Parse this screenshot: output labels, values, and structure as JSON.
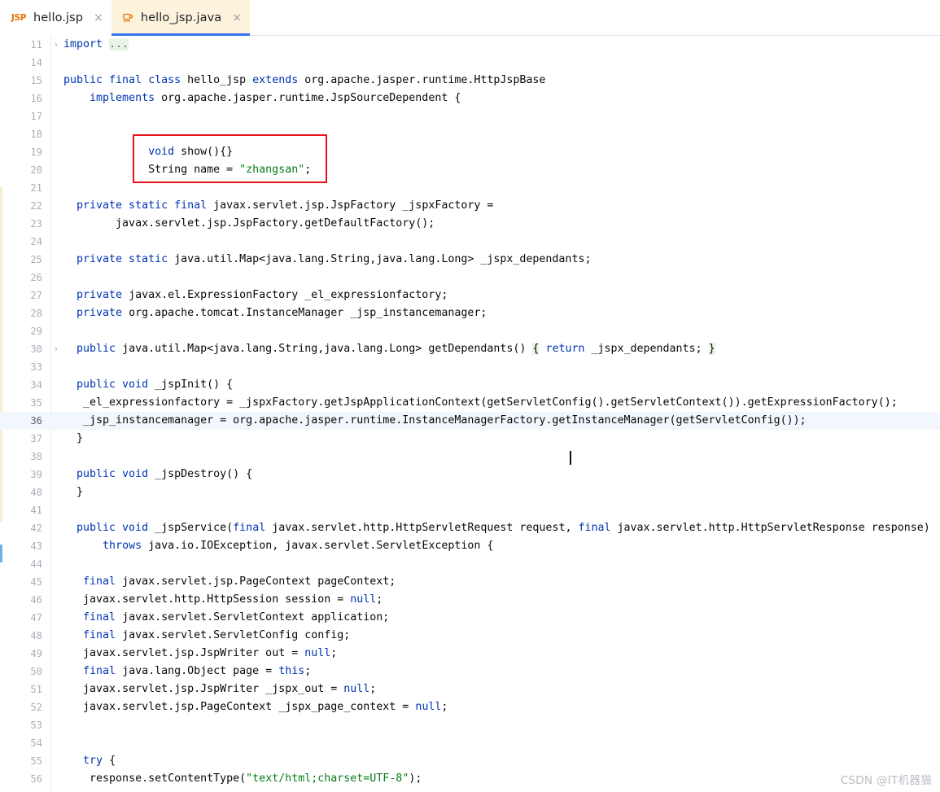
{
  "tabs": [
    {
      "label": "hello.jsp",
      "icon": "jsp-file-icon",
      "icon_text": "JSP",
      "close": "×",
      "active": false
    },
    {
      "label": "hello_jsp.java",
      "icon": "java-file-icon",
      "close": "×",
      "active": true
    }
  ],
  "colors": {
    "active_tab_bg": "#fdf3dc",
    "active_tab_underline": "#3574f0",
    "keyword": "#0033b3",
    "string": "#067d17",
    "annotation_box": "#e8131a",
    "current_line_bg": "#f2f6fd",
    "fold_highlight": "#e9f5e4",
    "line_number": "#aaaeb8"
  },
  "editor": {
    "current_line": 36,
    "lines": [
      {
        "n": "11",
        "fold": "›",
        "indent": 0,
        "tokens": [
          {
            "t": "import ",
            "c": "kw"
          },
          {
            "t": "...",
            "c": "ell"
          }
        ]
      },
      {
        "n": "14",
        "fold": "",
        "indent": 0,
        "tokens": []
      },
      {
        "n": "15",
        "fold": "",
        "indent": 0,
        "tokens": [
          {
            "t": "public final class ",
            "c": "kw"
          },
          {
            "t": "hello_jsp ",
            "c": "plain"
          },
          {
            "t": "extends ",
            "c": "kw"
          },
          {
            "t": "org.apache.jasper.runtime.HttpJspBase",
            "c": "plain"
          }
        ]
      },
      {
        "n": "16",
        "fold": "",
        "indent": 4,
        "tokens": [
          {
            "t": "implements ",
            "c": "kw"
          },
          {
            "t": "org.apache.jasper.runtime.JspSourceDependent {",
            "c": "plain"
          }
        ]
      },
      {
        "n": "17",
        "fold": "",
        "indent": 0,
        "tokens": []
      },
      {
        "n": "18",
        "fold": "",
        "indent": 0,
        "tokens": []
      },
      {
        "n": "19",
        "fold": "",
        "indent": 13,
        "tokens": [
          {
            "t": "void ",
            "c": "kw"
          },
          {
            "t": "show(){}",
            "c": "plain"
          }
        ]
      },
      {
        "n": "20",
        "fold": "",
        "indent": 13,
        "tokens": [
          {
            "t": "String name = ",
            "c": "plain"
          },
          {
            "t": "\"zhangsan\"",
            "c": "str"
          },
          {
            "t": ";",
            "c": "plain"
          }
        ]
      },
      {
        "n": "21",
        "fold": "",
        "indent": 0,
        "tokens": []
      },
      {
        "n": "22",
        "fold": "",
        "indent": 2,
        "tokens": [
          {
            "t": "private static final ",
            "c": "kw"
          },
          {
            "t": "javax.servlet.jsp.JspFactory _jspxFactory =",
            "c": "plain"
          }
        ]
      },
      {
        "n": "23",
        "fold": "",
        "indent": 8,
        "tokens": [
          {
            "t": "javax.servlet.jsp.JspFactory.getDefaultFactory();",
            "c": "plain"
          }
        ]
      },
      {
        "n": "24",
        "fold": "",
        "indent": 0,
        "tokens": []
      },
      {
        "n": "25",
        "fold": "",
        "indent": 2,
        "tokens": [
          {
            "t": "private static ",
            "c": "kw"
          },
          {
            "t": "java.util.Map<java.lang.String,java.lang.Long> _jspx_dependants;",
            "c": "plain"
          }
        ]
      },
      {
        "n": "26",
        "fold": "",
        "indent": 0,
        "tokens": []
      },
      {
        "n": "27",
        "fold": "",
        "indent": 2,
        "tokens": [
          {
            "t": "private ",
            "c": "kw"
          },
          {
            "t": "javax.el.ExpressionFactory _el_expressionfactory;",
            "c": "plain"
          }
        ]
      },
      {
        "n": "28",
        "fold": "",
        "indent": 2,
        "tokens": [
          {
            "t": "private ",
            "c": "kw"
          },
          {
            "t": "org.apache.tomcat.InstanceManager _jsp_instancemanager;",
            "c": "plain"
          }
        ]
      },
      {
        "n": "29",
        "fold": "",
        "indent": 0,
        "tokens": []
      },
      {
        "n": "30",
        "fold": "›",
        "indent": 2,
        "tokens": [
          {
            "t": "public ",
            "c": "kw"
          },
          {
            "t": "java.util.Map<java.lang.String,java.lang.Long> getDependants() ",
            "c": "plain"
          },
          {
            "t": "{",
            "c": "foldmark"
          },
          {
            "t": " ",
            "c": "plain"
          },
          {
            "t": "return",
            "c": "kw"
          },
          {
            "t": " _jspx_dependants; ",
            "c": "plain"
          },
          {
            "t": "}",
            "c": "foldmark"
          }
        ]
      },
      {
        "n": "33",
        "fold": "",
        "indent": 0,
        "tokens": []
      },
      {
        "n": "34",
        "fold": "",
        "indent": 2,
        "tokens": [
          {
            "t": "public void ",
            "c": "kw"
          },
          {
            "t": "_jspInit() {",
            "c": "plain"
          }
        ]
      },
      {
        "n": "35",
        "fold": "",
        "indent": 3,
        "tokens": [
          {
            "t": "_el_expressionfactory = _jspxFactory.getJspApplicationContext(getServletConfig().getServletContext()).getExpressionFactory();",
            "c": "plain"
          }
        ]
      },
      {
        "n": "36",
        "fold": "",
        "indent": 3,
        "tokens": [
          {
            "t": "_jsp_instancemanager = org.apache.jasper.runtime.InstanceManagerFactory.getInstanceManager(getServletConfig());",
            "c": "plain"
          }
        ]
      },
      {
        "n": "37",
        "fold": "",
        "indent": 2,
        "tokens": [
          {
            "t": "}",
            "c": "plain"
          }
        ]
      },
      {
        "n": "38",
        "fold": "",
        "indent": 0,
        "tokens": []
      },
      {
        "n": "39",
        "fold": "",
        "indent": 2,
        "tokens": [
          {
            "t": "public void ",
            "c": "kw"
          },
          {
            "t": "_jspDestroy() {",
            "c": "plain"
          }
        ]
      },
      {
        "n": "40",
        "fold": "",
        "indent": 2,
        "tokens": [
          {
            "t": "}",
            "c": "plain"
          }
        ]
      },
      {
        "n": "41",
        "fold": "",
        "indent": 0,
        "tokens": []
      },
      {
        "n": "42",
        "fold": "",
        "indent": 2,
        "tokens": [
          {
            "t": "public void ",
            "c": "kw"
          },
          {
            "t": "_jspService(",
            "c": "plain"
          },
          {
            "t": "final",
            "c": "kw"
          },
          {
            "t": " javax.servlet.http.HttpServletRequest request, ",
            "c": "plain"
          },
          {
            "t": "final",
            "c": "kw"
          },
          {
            "t": " javax.servlet.http.HttpServletResponse response)",
            "c": "plain"
          }
        ]
      },
      {
        "n": "43",
        "fold": "",
        "indent": 6,
        "tokens": [
          {
            "t": "throws",
            "c": "kw"
          },
          {
            "t": " java.io.IOException, javax.servlet.ServletException {",
            "c": "plain"
          }
        ]
      },
      {
        "n": "44",
        "fold": "",
        "indent": 0,
        "tokens": []
      },
      {
        "n": "45",
        "fold": "",
        "indent": 3,
        "tokens": [
          {
            "t": "final",
            "c": "kw"
          },
          {
            "t": " javax.servlet.jsp.PageContext pageContext;",
            "c": "plain"
          }
        ]
      },
      {
        "n": "46",
        "fold": "",
        "indent": 3,
        "tokens": [
          {
            "t": "javax.servlet.http.HttpSession session = ",
            "c": "plain"
          },
          {
            "t": "null",
            "c": "kw"
          },
          {
            "t": ";",
            "c": "plain"
          }
        ]
      },
      {
        "n": "47",
        "fold": "",
        "indent": 3,
        "tokens": [
          {
            "t": "final",
            "c": "kw"
          },
          {
            "t": " javax.servlet.ServletContext application;",
            "c": "plain"
          }
        ]
      },
      {
        "n": "48",
        "fold": "",
        "indent": 3,
        "tokens": [
          {
            "t": "final",
            "c": "kw"
          },
          {
            "t": " javax.servlet.ServletConfig config;",
            "c": "plain"
          }
        ]
      },
      {
        "n": "49",
        "fold": "",
        "indent": 3,
        "tokens": [
          {
            "t": "javax.servlet.jsp.JspWriter out = ",
            "c": "plain"
          },
          {
            "t": "null",
            "c": "kw"
          },
          {
            "t": ";",
            "c": "plain"
          }
        ]
      },
      {
        "n": "50",
        "fold": "",
        "indent": 3,
        "tokens": [
          {
            "t": "final",
            "c": "kw"
          },
          {
            "t": " java.lang.Object page = ",
            "c": "plain"
          },
          {
            "t": "this",
            "c": "kw"
          },
          {
            "t": ";",
            "c": "plain"
          }
        ]
      },
      {
        "n": "51",
        "fold": "",
        "indent": 3,
        "tokens": [
          {
            "t": "javax.servlet.jsp.JspWriter _jspx_out = ",
            "c": "plain"
          },
          {
            "t": "null",
            "c": "kw"
          },
          {
            "t": ";",
            "c": "plain"
          }
        ]
      },
      {
        "n": "52",
        "fold": "",
        "indent": 3,
        "tokens": [
          {
            "t": "javax.servlet.jsp.PageContext _jspx_page_context = ",
            "c": "plain"
          },
          {
            "t": "null",
            "c": "kw"
          },
          {
            "t": ";",
            "c": "plain"
          }
        ]
      },
      {
        "n": "53",
        "fold": "",
        "indent": 0,
        "tokens": []
      },
      {
        "n": "54",
        "fold": "",
        "indent": 0,
        "tokens": []
      },
      {
        "n": "55",
        "fold": "",
        "indent": 3,
        "tokens": [
          {
            "t": "try",
            "c": "kw"
          },
          {
            "t": " {",
            "c": "plain"
          }
        ]
      },
      {
        "n": "56",
        "fold": "",
        "indent": 4,
        "tokens": [
          {
            "t": "response.setContentType(",
            "c": "plain"
          },
          {
            "t": "\"text/html;charset=UTF-8\"",
            "c": "str"
          },
          {
            "t": ");",
            "c": "plain"
          }
        ]
      }
    ]
  },
  "annotation": {
    "name": "red-highlight-box",
    "target_lines": [
      "19",
      "20"
    ]
  },
  "watermark": {
    "text": "CSDN @IT机器猫"
  }
}
